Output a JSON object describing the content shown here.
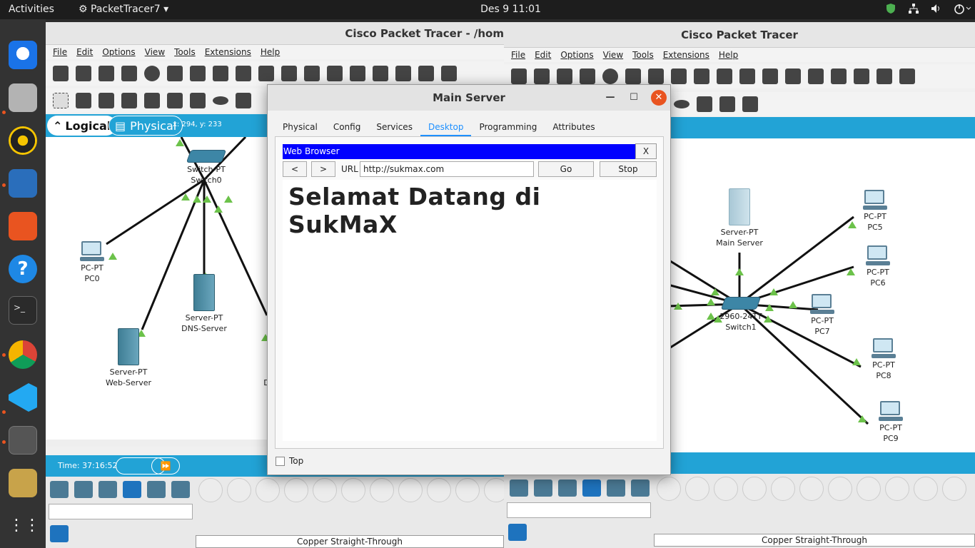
{
  "topbar": {
    "activities": "Activities",
    "app_name": "PacketTracer7",
    "clock": "Des 9  11:01"
  },
  "left_window": {
    "title": "Cisco Packet Tracer - /hom",
    "menu": [
      "File",
      "Edit",
      "Options",
      "View",
      "Tools",
      "Extensions",
      "Help"
    ],
    "logical_tab": "Logical",
    "physical_tab": "Physical",
    "coords": "x: 294, y: 233",
    "time_label": "Time: 37:16:52",
    "cable_label": "Copper Straight-Through",
    "devices": [
      {
        "type": "PC-PT",
        "name": "PC0"
      },
      {
        "type": "Server-PT",
        "name": "DNS-Server"
      },
      {
        "type": "Server-PT",
        "name": "Web-Server"
      },
      {
        "type": "Switch-PT",
        "name": "Switch0"
      },
      {
        "type": "S",
        "name": "DH"
      }
    ]
  },
  "right_window": {
    "title": "Cisco Packet Tracer",
    "menu": [
      "File",
      "Edit",
      "Options",
      "View",
      "Tools",
      "Extensions",
      "Help"
    ],
    "cable_label": "Copper Straight-Through",
    "devices": [
      {
        "type": "Server-PT",
        "name": "Main Server"
      },
      {
        "type": "2960-24TT",
        "name": "Switch1"
      },
      {
        "type": "PC-PT",
        "name": "PC5"
      },
      {
        "type": "PC-PT",
        "name": "PC6"
      },
      {
        "type": "PC-PT",
        "name": "PC7"
      },
      {
        "type": "PC-PT",
        "name": "PC8"
      },
      {
        "type": "PC-PT",
        "name": "PC9"
      }
    ]
  },
  "dialog": {
    "title": "Main Server",
    "tabs": [
      "Physical",
      "Config",
      "Services",
      "Desktop",
      "Programming",
      "Attributes"
    ],
    "active_tab": "Desktop",
    "browser": {
      "header": "Web Browser",
      "close_label": "X",
      "back_label": "<",
      "forward_label": ">",
      "url_label": "URL",
      "url_value": "http://sukmax.com",
      "go_label": "Go",
      "stop_label": "Stop",
      "page_heading": "Selamat Datang di SukMaX"
    },
    "top_checkbox_label": "Top"
  },
  "colors": {
    "accent_orange": "#e95420",
    "band_blue": "#22a3d6",
    "browser_header": "#0000ff",
    "link_green": "#6cc24a"
  }
}
